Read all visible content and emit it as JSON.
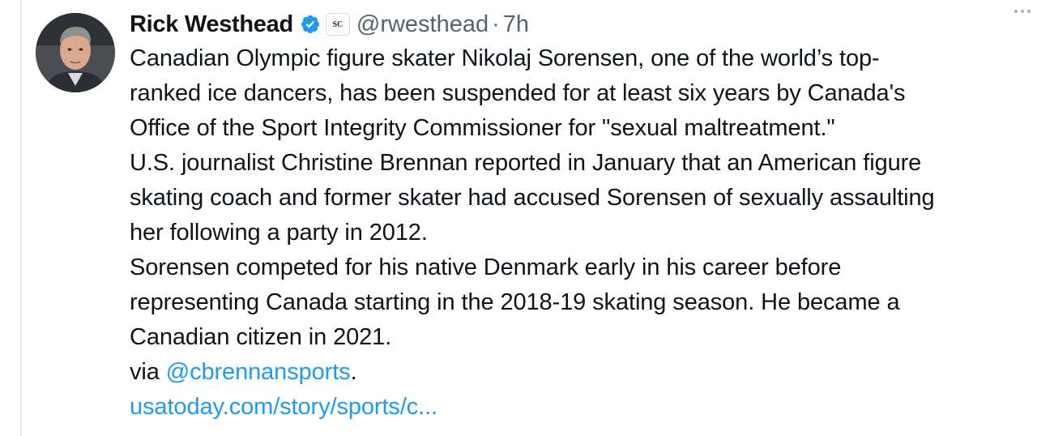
{
  "tweet": {
    "display_name": "Rick Westhead",
    "affiliate_badge": "SC",
    "handle": "@rwesthead",
    "separator": "·",
    "time": "7h",
    "lines": [
      "Canadian Olympic figure skater Nikolaj Sorensen, one of the world’s top-",
      "ranked ice dancers, has been suspended for at least six years by Canada's",
      "Office of the Sport Integrity Commissioner for \"sexual maltreatment.\"",
      "U.S. journalist Christine Brennan reported in January that an American figure",
      "skating coach and former skater had accused Sorensen of sexually assaulting",
      "her following a party in 2012.",
      "Sorensen competed for his native Denmark early in his career before",
      "representing Canada starting in the 2018-19 skating season. He became a",
      "Canadian citizen in 2021."
    ],
    "via_prefix": "via ",
    "mention": "@cbrennansports",
    "via_suffix": ".",
    "link": "usatoday.com/story/sports/c..."
  },
  "colors": {
    "text": "#0f1419",
    "secondary": "#536471",
    "link": "#1d9bf0",
    "verified": "#1d9bf0"
  },
  "icons": {
    "verified": "verified-badge-icon",
    "more": "more-dots-icon"
  }
}
